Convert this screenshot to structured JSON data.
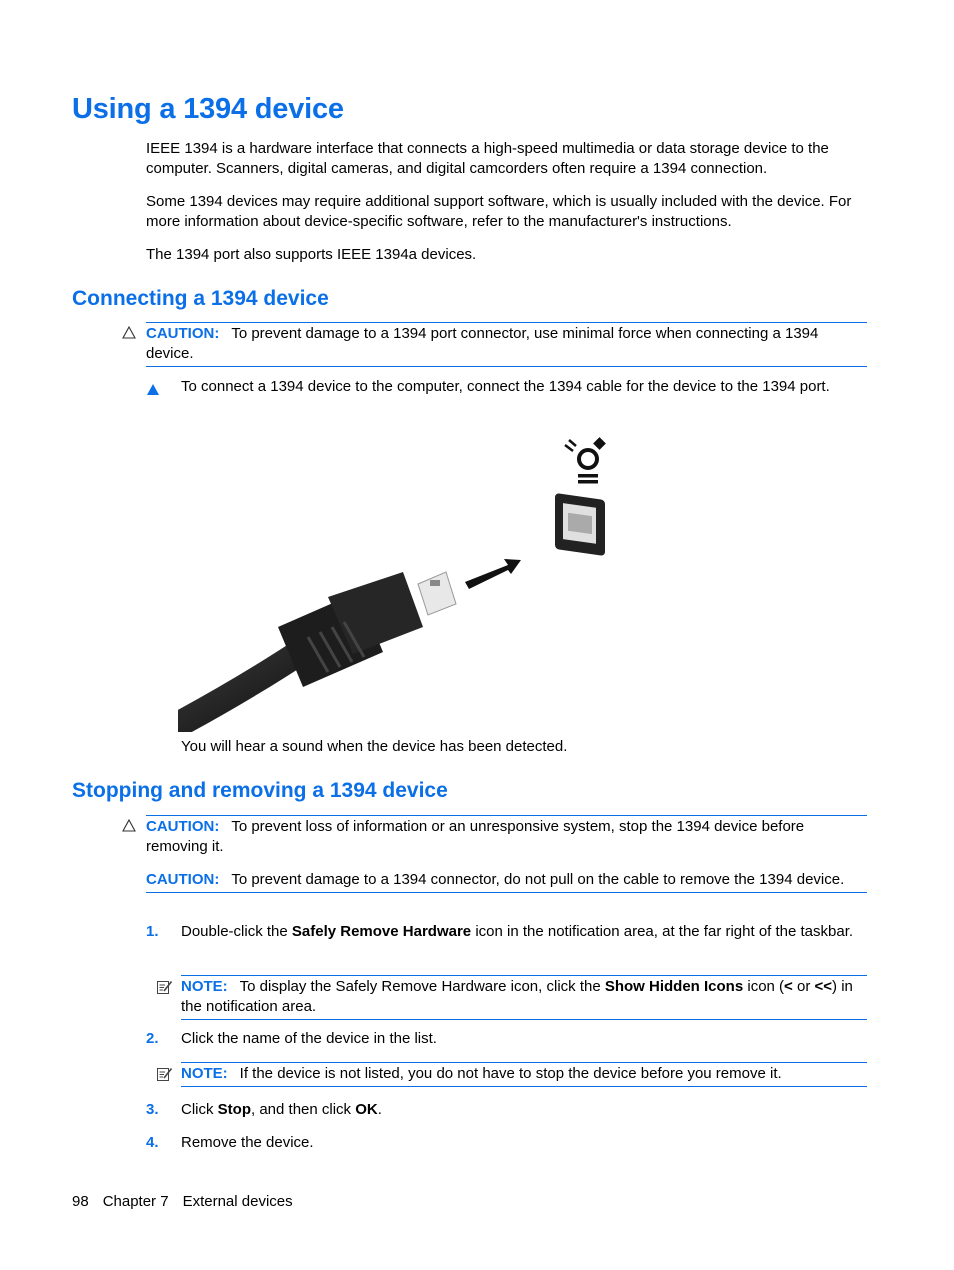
{
  "page": {
    "title": "Using a 1394 device",
    "intro": [
      "IEEE 1394 is a hardware interface that connects a high-speed multimedia or data storage device to the computer. Scanners, digital cameras, and digital camcorders often require a 1394 connection.",
      "Some 1394 devices may require additional support software, which is usually included with the device. For more information about device-specific software, refer to the manufacturer's instructions.",
      "The 1394 port also supports IEEE 1394a devices."
    ]
  },
  "connecting": {
    "heading": "Connecting a 1394 device",
    "caution": {
      "label": "CAUTION:",
      "text": "To prevent damage to a 1394 port connector, use minimal force when connecting a 1394 device."
    },
    "step": "To connect a 1394 device to the computer, connect the 1394 cable for the device to the 1394 port.",
    "figure": {
      "description": "1394 cable connector being inserted into 1394 port with arrow and 1394 symbol"
    },
    "after": "You will hear a sound when the device has been detected."
  },
  "stopping": {
    "heading": "Stopping and removing a 1394 device",
    "cautions": [
      {
        "label": "CAUTION:",
        "text": "To prevent loss of information or an unresponsive system, stop the 1394 device before removing it."
      },
      {
        "label": "CAUTION:",
        "text": "To prevent damage to a 1394 connector, do not pull on the cable to remove the 1394 device."
      }
    ],
    "steps": [
      {
        "num": "1.",
        "pre": "Double-click the ",
        "bold": "Safely Remove Hardware",
        "post": " icon in the notification area, at the far right of the taskbar."
      },
      {
        "num": "2.",
        "text": "Click the name of the device in the list."
      },
      {
        "num": "3.",
        "pre": "Click ",
        "bold": "Stop",
        "mid": ", and then click ",
        "bold2": "OK",
        "post": "."
      },
      {
        "num": "4.",
        "text": "Remove the device."
      }
    ],
    "notes": [
      {
        "label": "NOTE:",
        "pre": "To display the Safely Remove Hardware icon, click the ",
        "bold": "Show Hidden Icons",
        "mid": " icon (",
        "bold2": "<",
        "mid2": " or ",
        "bold3": "<<",
        "post": ") in the notification area."
      },
      {
        "label": "NOTE:",
        "text": "If the device is not listed, you do not have to stop the device before you remove it."
      }
    ]
  },
  "footer": {
    "page_number": "98",
    "chapter": "Chapter 7",
    "chapter_title": "External devices"
  }
}
